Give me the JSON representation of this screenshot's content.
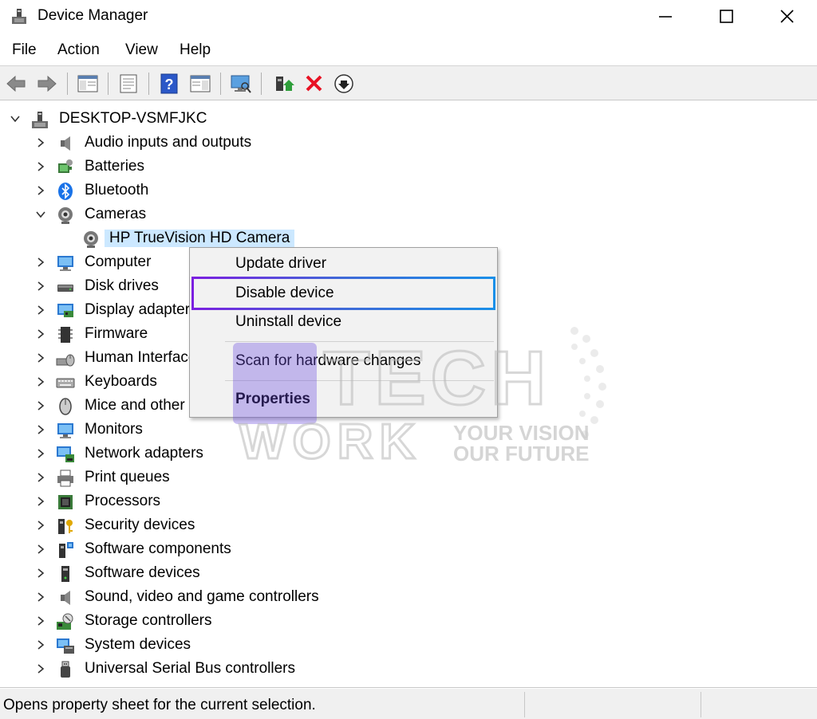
{
  "window": {
    "title": "Device Manager",
    "minimize_icon": "minimize-icon",
    "maximize_icon": "maximize-icon",
    "close_icon": "close-icon"
  },
  "menu": {
    "file": "File",
    "action": "Action",
    "view": "View",
    "help": "Help"
  },
  "toolbar": {
    "buttons": [
      "back-arrow-icon",
      "forward-arrow-icon",
      "show-hide-console-tree-icon",
      "properties-icon",
      "help-icon",
      "action-pane-icon",
      "scan-hardware-icon",
      "update-driver-icon",
      "uninstall-icon",
      "disable-icon"
    ],
    "uninstall_color": "#e81123"
  },
  "tree": {
    "root": "DESKTOP-VSMFJKC",
    "categories": [
      {
        "label": "Audio inputs and outputs",
        "icon": "speaker-icon"
      },
      {
        "label": "Batteries",
        "icon": "battery-icon"
      },
      {
        "label": "Bluetooth",
        "icon": "bluetooth-icon"
      },
      {
        "label": "Cameras",
        "icon": "camera-icon",
        "expanded": true
      },
      {
        "label": "Computer",
        "icon": "computer-icon"
      },
      {
        "label": "Disk drives",
        "icon": "disk-drive-icon"
      },
      {
        "label": "Display adapters",
        "icon": "display-adapter-icon"
      },
      {
        "label": "Firmware",
        "icon": "firmware-icon"
      },
      {
        "label": "Human Interface Devices",
        "icon": "hid-icon"
      },
      {
        "label": "Keyboards",
        "icon": "keyboard-icon"
      },
      {
        "label": "Mice and other pointing devices",
        "icon": "mouse-icon"
      },
      {
        "label": "Monitors",
        "icon": "monitor-icon"
      },
      {
        "label": "Network adapters",
        "icon": "network-icon"
      },
      {
        "label": "Print queues",
        "icon": "printer-icon"
      },
      {
        "label": "Processors",
        "icon": "processor-icon"
      },
      {
        "label": "Security devices",
        "icon": "security-icon"
      },
      {
        "label": "Software components",
        "icon": "software-component-icon"
      },
      {
        "label": "Software devices",
        "icon": "software-device-icon"
      },
      {
        "label": "Sound, video and game controllers",
        "icon": "sound-icon"
      },
      {
        "label": "Storage controllers",
        "icon": "storage-icon"
      },
      {
        "label": "System devices",
        "icon": "system-icon"
      },
      {
        "label": "Universal Serial Bus controllers",
        "icon": "usb-icon"
      }
    ],
    "camera_child": "HP TrueVision HD Camera",
    "selection_color": "#cce8ff"
  },
  "context_menu": {
    "update_driver": "Update driver",
    "disable_device": "Disable device",
    "uninstall_device": "Uninstall device",
    "scan_hardware": "Scan for hardware changes",
    "properties": "Properties",
    "highlight_colors": [
      "#7b1fe0",
      "#1a8fe8"
    ]
  },
  "watermark": {
    "line1": "TECH",
    "line2": "WORK",
    "tagline1": "YOUR VISION",
    "tagline2": "OUR FUTURE"
  },
  "status": {
    "text": "Opens property sheet for the current selection."
  }
}
